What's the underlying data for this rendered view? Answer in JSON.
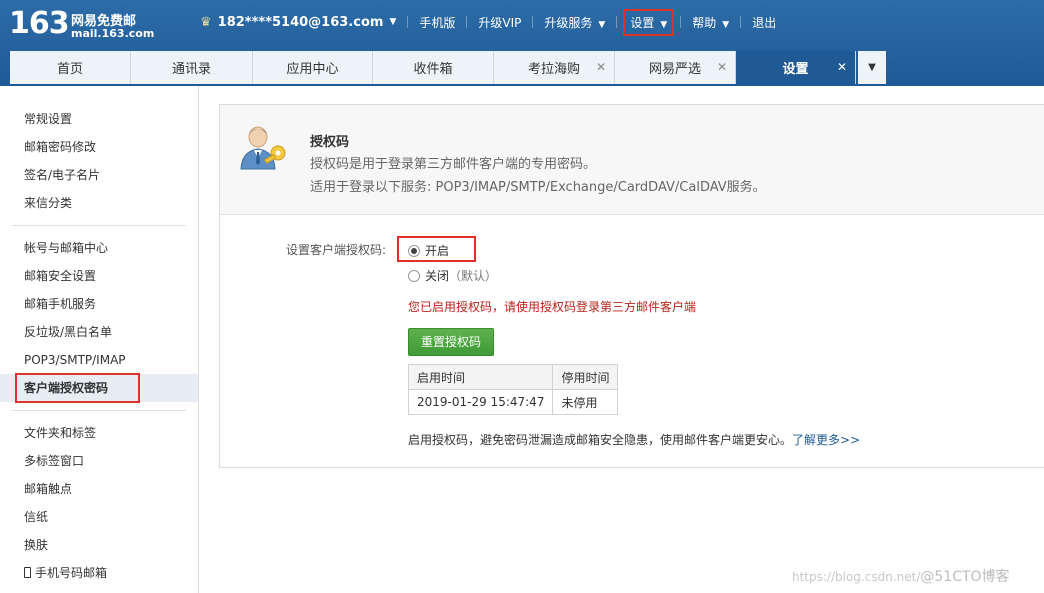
{
  "logo": {
    "number": "163",
    "brand": "网易免费邮",
    "url": "mail.163.com"
  },
  "topnav": {
    "user": "182****5140@163.com",
    "mobile": "手机版",
    "vip": "升级VIP",
    "upgrade_service": "升级服务",
    "settings": "设置",
    "help": "帮助",
    "logout": "退出"
  },
  "tabs": [
    {
      "label": "首页"
    },
    {
      "label": "通讯录"
    },
    {
      "label": "应用中心"
    },
    {
      "label": "收件箱"
    },
    {
      "label": "考拉海购"
    },
    {
      "label": "网易严选"
    },
    {
      "label": "设置"
    }
  ],
  "sidebar": {
    "group1": [
      "常规设置",
      "邮箱密码修改",
      "签名/电子名片",
      "来信分类"
    ],
    "group2": [
      "帐号与邮箱中心",
      "邮箱安全设置",
      "邮箱手机服务",
      "反垃圾/黑白名单",
      "POP3/SMTP/IMAP",
      "客户端授权密码"
    ],
    "group3": [
      "文件夹和标签",
      "多标签窗口",
      "邮箱触点",
      "信纸",
      "换肤",
      "手机号码邮箱"
    ]
  },
  "auth": {
    "title": "授权码",
    "desc1": "授权码是用于登录第三方邮件客户端的专用密码。",
    "desc2": "适用于登录以下服务: POP3/IMAP/SMTP/Exchange/CardDAV/CalDAV服务。",
    "setting_label": "设置客户端授权码:",
    "option_on": "开启",
    "option_off": "关闭",
    "option_off_note": "（默认）",
    "notice": "您已启用授权码，请使用授权码登录第三方邮件客户端",
    "reset_button": "重置授权码",
    "table_headers": [
      "启用时间",
      "停用时间"
    ],
    "table_row": [
      "2019-01-29 15:47:47",
      "未停用"
    ],
    "footer": "启用授权码，避免密码泄漏造成邮箱安全隐患，使用邮件客户端更安心。",
    "learn_more": "了解更多>>"
  },
  "watermark": {
    "url": "https://blog.csdn.net/",
    "brand": "@51CTO博客"
  },
  "colors": {
    "header": "#1f5a95",
    "highlight": "#e0302a",
    "green": "#4ca53f",
    "notice": "#b8231b"
  }
}
